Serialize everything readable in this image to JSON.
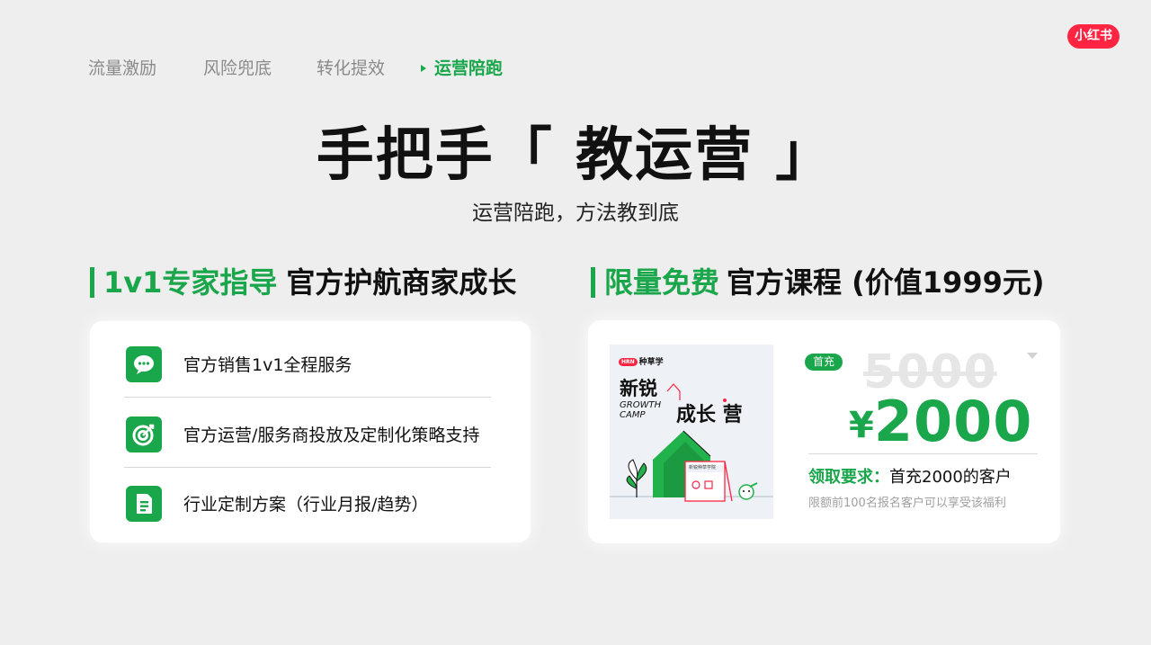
{
  "logo": {
    "text": "小红书"
  },
  "nav": {
    "tabs": [
      {
        "label": "流量激励"
      },
      {
        "label": "风险兜底"
      },
      {
        "label": "转化提效"
      },
      {
        "label": "运营陪跑",
        "active": true
      }
    ]
  },
  "hero": {
    "title": "手把手「 教运营 」",
    "subtitle": "运营陪跑，方法教到底"
  },
  "left_section": {
    "highlight": "1v1专家指导",
    "rest": "官方护航商家成长",
    "items": [
      {
        "icon": "chat-bubble-icon",
        "label": "官方销售1v1全程服务"
      },
      {
        "icon": "target-icon",
        "label": "官方运营/服务商投放及定制化策略支持"
      },
      {
        "icon": "document-icon",
        "label": "行业定制方案（行业月报/趋势）"
      }
    ]
  },
  "right_section": {
    "highlight": "限量免费",
    "rest": "官方课程 (价值1999元)",
    "poster": {
      "brand_pill": "HRN",
      "brand_text": "种草学",
      "line1": "新锐",
      "growth": "GROWTH",
      "camp": "CAMP",
      "line2": "成长 营",
      "sign_text": "新锐种草学院"
    },
    "badge": "首充",
    "old_price": "5000",
    "currency": "¥",
    "new_price": "2000",
    "requirement_label": "领取要求：",
    "requirement_value": "首充2000的客户",
    "note": "限额前100名报名客户可以享受该福利"
  },
  "colors": {
    "accent": "#1aa64a",
    "brand_red": "#ff2442",
    "background": "#eeeeee"
  }
}
